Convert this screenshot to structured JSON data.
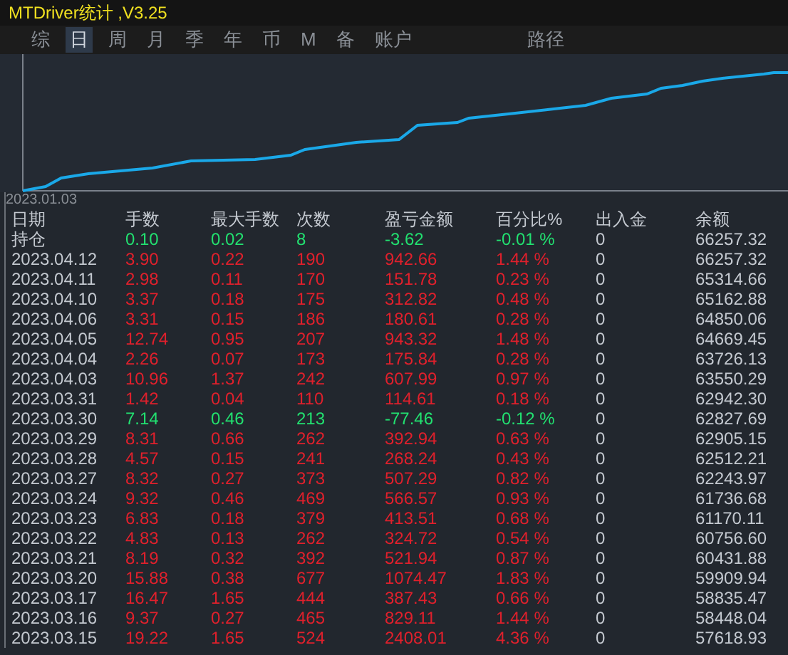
{
  "window": {
    "title": "MTDriver统计 ,V3.25"
  },
  "tabs": [
    {
      "label": "综",
      "selected": false
    },
    {
      "label": "日",
      "selected": true
    },
    {
      "label": "周",
      "selected": false
    },
    {
      "label": "月",
      "selected": false
    },
    {
      "label": "季",
      "selected": false
    },
    {
      "label": "年",
      "selected": false
    },
    {
      "label": "币",
      "selected": false
    },
    {
      "label": "M",
      "selected": false
    },
    {
      "label": "备",
      "selected": false
    },
    {
      "label": "账户",
      "selected": false
    },
    {
      "label": "路径",
      "selected": false
    }
  ],
  "equity_chart": {
    "start_label": "2023.01.03"
  },
  "table": {
    "columns": [
      "日期",
      "手数",
      "最大手数",
      "次数",
      "盈亏金额",
      "百分比%",
      "出入金",
      "余额"
    ],
    "rows": [
      {
        "kind": "loss",
        "cells": [
          "持仓",
          "0.10",
          "0.02",
          "8",
          "-3.62",
          "-0.01 %",
          "0",
          "66257.32"
        ]
      },
      {
        "kind": "gain",
        "cells": [
          "2023.04.12",
          "3.90",
          "0.22",
          "190",
          "942.66",
          "1.44 %",
          "0",
          "66257.32"
        ]
      },
      {
        "kind": "gain",
        "cells": [
          "2023.04.11",
          "2.98",
          "0.11",
          "170",
          "151.78",
          "0.23 %",
          "0",
          "65314.66"
        ]
      },
      {
        "kind": "gain",
        "cells": [
          "2023.04.10",
          "3.37",
          "0.18",
          "175",
          "312.82",
          "0.48 %",
          "0",
          "65162.88"
        ]
      },
      {
        "kind": "gain",
        "cells": [
          "2023.04.06",
          "3.31",
          "0.15",
          "186",
          "180.61",
          "0.28 %",
          "0",
          "64850.06"
        ]
      },
      {
        "kind": "gain",
        "cells": [
          "2023.04.05",
          "12.74",
          "0.95",
          "207",
          "943.32",
          "1.48 %",
          "0",
          "64669.45"
        ]
      },
      {
        "kind": "gain",
        "cells": [
          "2023.04.04",
          "2.26",
          "0.07",
          "173",
          "175.84",
          "0.28 %",
          "0",
          "63726.13"
        ]
      },
      {
        "kind": "gain",
        "cells": [
          "2023.04.03",
          "10.96",
          "1.37",
          "242",
          "607.99",
          "0.97 %",
          "0",
          "63550.29"
        ]
      },
      {
        "kind": "gain",
        "cells": [
          "2023.03.31",
          "1.42",
          "0.04",
          "110",
          "114.61",
          "0.18 %",
          "0",
          "62942.30"
        ]
      },
      {
        "kind": "loss",
        "cells": [
          "2023.03.30",
          "7.14",
          "0.46",
          "213",
          "-77.46",
          "-0.12 %",
          "0",
          "62827.69"
        ]
      },
      {
        "kind": "gain",
        "cells": [
          "2023.03.29",
          "8.31",
          "0.66",
          "262",
          "392.94",
          "0.63 %",
          "0",
          "62905.15"
        ]
      },
      {
        "kind": "gain",
        "cells": [
          "2023.03.28",
          "4.57",
          "0.15",
          "241",
          "268.24",
          "0.43 %",
          "0",
          "62512.21"
        ]
      },
      {
        "kind": "gain",
        "cells": [
          "2023.03.27",
          "8.32",
          "0.27",
          "373",
          "507.29",
          "0.82 %",
          "0",
          "62243.97"
        ]
      },
      {
        "kind": "gain",
        "cells": [
          "2023.03.24",
          "9.32",
          "0.46",
          "469",
          "566.57",
          "0.93 %",
          "0",
          "61736.68"
        ]
      },
      {
        "kind": "gain",
        "cells": [
          "2023.03.23",
          "6.83",
          "0.18",
          "379",
          "413.51",
          "0.68 %",
          "0",
          "61170.11"
        ]
      },
      {
        "kind": "gain",
        "cells": [
          "2023.03.22",
          "4.83",
          "0.13",
          "262",
          "324.72",
          "0.54 %",
          "0",
          "60756.60"
        ]
      },
      {
        "kind": "gain",
        "cells": [
          "2023.03.21",
          "8.19",
          "0.32",
          "392",
          "521.94",
          "0.87 %",
          "0",
          "60431.88"
        ]
      },
      {
        "kind": "gain",
        "cells": [
          "2023.03.20",
          "15.88",
          "0.38",
          "677",
          "1074.47",
          "1.83 %",
          "0",
          "59909.94"
        ]
      },
      {
        "kind": "gain",
        "cells": [
          "2023.03.17",
          "16.47",
          "1.65",
          "444",
          "387.43",
          "0.66 %",
          "0",
          "58835.47"
        ]
      },
      {
        "kind": "gain",
        "cells": [
          "2023.03.16",
          "9.37",
          "0.27",
          "465",
          "829.11",
          "1.44 %",
          "0",
          "58448.04"
        ]
      },
      {
        "kind": "gain",
        "cells": [
          "2023.03.15",
          "19.22",
          "1.65",
          "524",
          "2408.01",
          "4.36 %",
          "0",
          "57618.93"
        ]
      }
    ]
  }
}
